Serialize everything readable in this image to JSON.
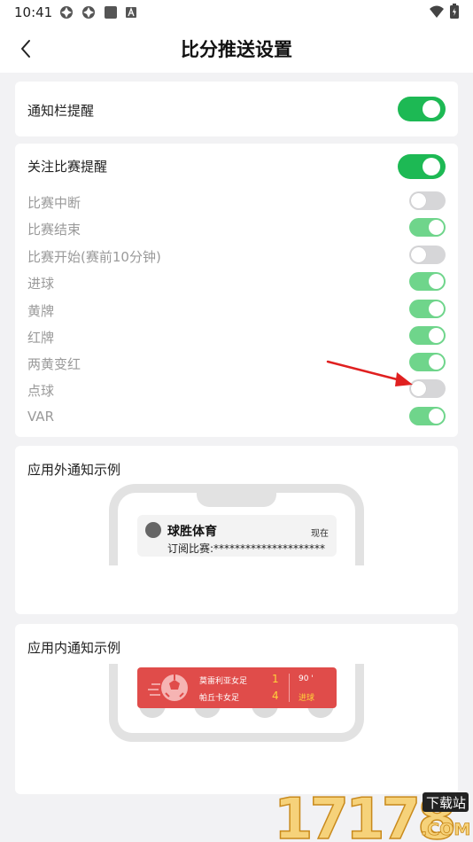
{
  "status_bar": {
    "time": "10:41"
  },
  "header": {
    "title": "比分推送设置"
  },
  "notification_bar": {
    "label": "通知栏提醒",
    "enabled": true
  },
  "follow_match": {
    "label": "关注比赛提醒",
    "enabled": true,
    "items": [
      {
        "label": "比赛中断",
        "enabled": false
      },
      {
        "label": "比赛结束",
        "enabled": true
      },
      {
        "label": "比赛开始(赛前10分钟)",
        "enabled": false
      },
      {
        "label": "进球",
        "enabled": true
      },
      {
        "label": "黄牌",
        "enabled": true
      },
      {
        "label": "红牌",
        "enabled": true
      },
      {
        "label": "两黄变红",
        "enabled": true
      },
      {
        "label": "点球",
        "enabled": false
      },
      {
        "label": "VAR",
        "enabled": true
      }
    ]
  },
  "outside_example": {
    "title": "应用外通知示例",
    "app_name": "球胜体育",
    "time": "现在",
    "body": "订阅比赛:*********************"
  },
  "inside_example": {
    "title": "应用内通知示例",
    "home_team": "莫雷利亚女足",
    "away_team": "帕丘卡女足",
    "home_score": "1",
    "away_score": "4",
    "minute": "90 '",
    "event": "进球"
  },
  "watermark": {
    "number": "17178",
    "site": "下载站",
    "com": ".COM"
  },
  "colors": {
    "toggle_on": "#1db954",
    "toggle_on_faded": "#6fd58b",
    "toggle_off": "#d6d6d8",
    "banner": "#e04c4a",
    "arrow": "#e02020"
  }
}
